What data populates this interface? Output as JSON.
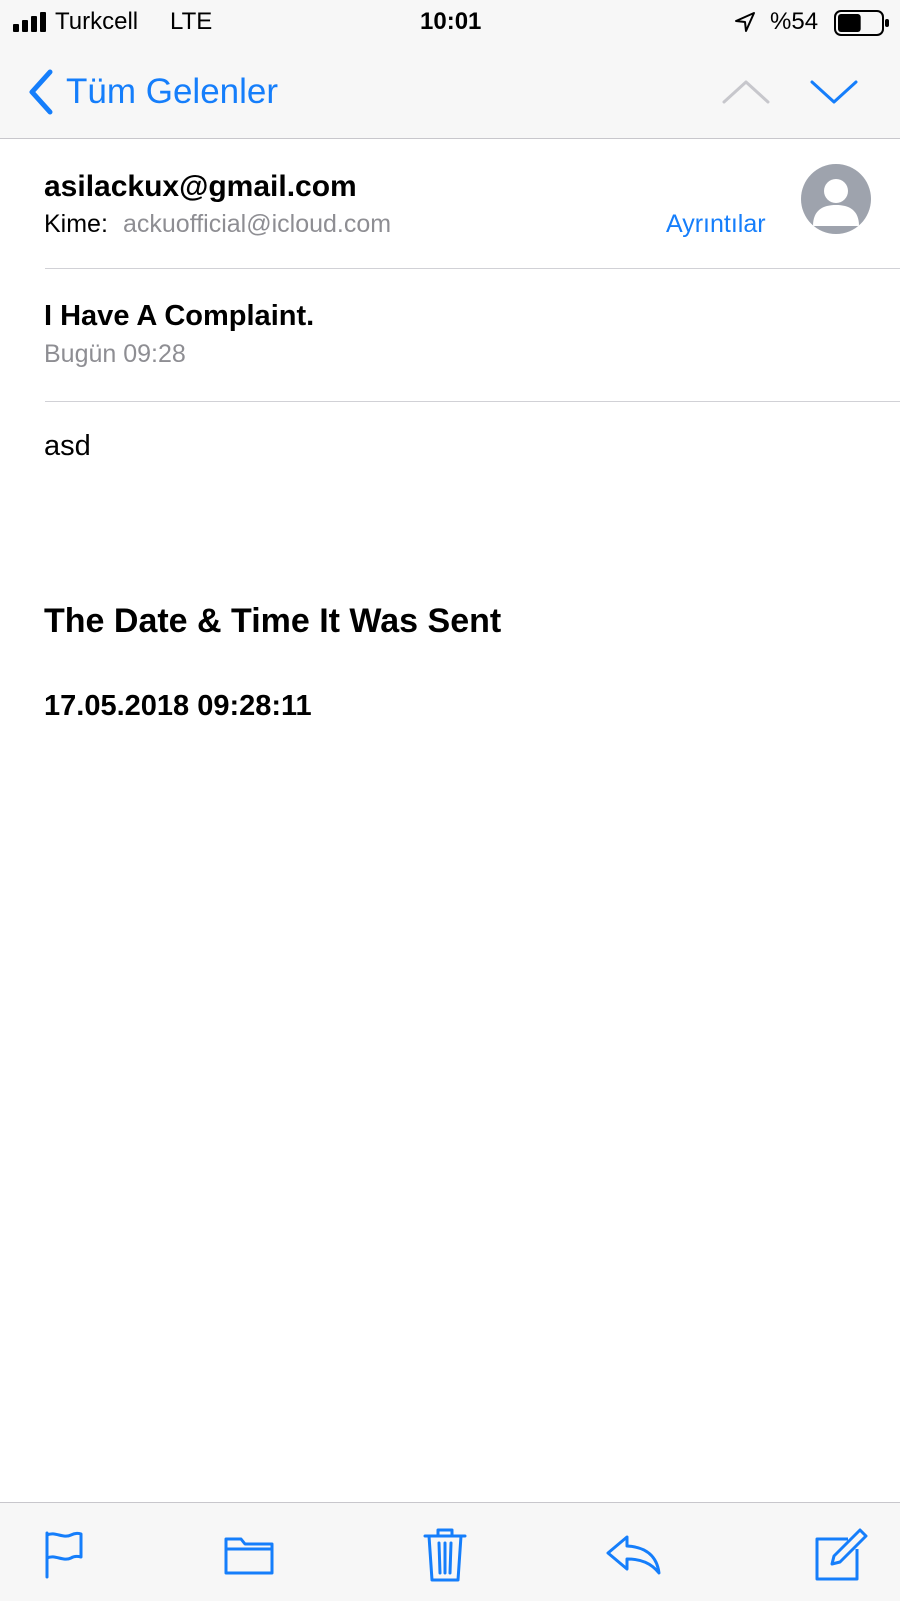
{
  "status_bar": {
    "carrier": "Turkcell",
    "network": "LTE",
    "time": "10:01",
    "battery": "%54",
    "battery_level": 0.54,
    "icons": [
      "signal-bars-icon",
      "location-arrow-icon",
      "battery-icon"
    ]
  },
  "nav": {
    "back_label": "Tüm Gelenler",
    "icons": [
      "chevron-left-icon",
      "chevron-up-icon",
      "chevron-down-icon"
    ]
  },
  "email": {
    "from": "asilackux@gmail.com",
    "to_label": "Kime:",
    "to": "ackuofficial@icloud.com",
    "details_label": "Ayrıntılar",
    "subject": "I Have A Complaint.",
    "date": "Bugün 09:28",
    "body": {
      "text": "asd",
      "heading": "The Date & Time It Was Sent",
      "timestamp": "17.05.2018 09:28:11"
    }
  },
  "toolbar": {
    "icons": [
      "flag-icon",
      "folder-icon",
      "trash-icon",
      "reply-icon",
      "compose-icon"
    ]
  },
  "colors": {
    "accent": "#157efb",
    "secondary_text": "#8e8e93",
    "bar_background": "#f7f7f7",
    "avatar": "#9ea3ad"
  }
}
